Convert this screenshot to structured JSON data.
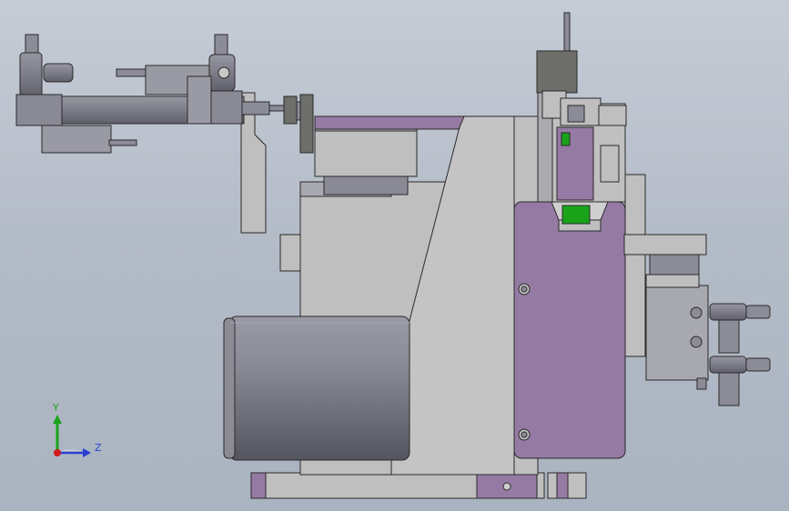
{
  "viewport": {
    "background_top": "#c6ccd6",
    "background_bottom": "#aab3c0",
    "part_colors": {
      "metal": "#bfbfbf",
      "steel": "#8c8c99",
      "purple": "#957aa3",
      "green": "#1aa31a",
      "edge": "#2a2a2a"
    }
  },
  "triad": {
    "y_label": "Y",
    "z_label": "Z",
    "y_color": "#1aa31a",
    "z_color": "#2b3fd1",
    "origin_color": "#d11a1a"
  }
}
